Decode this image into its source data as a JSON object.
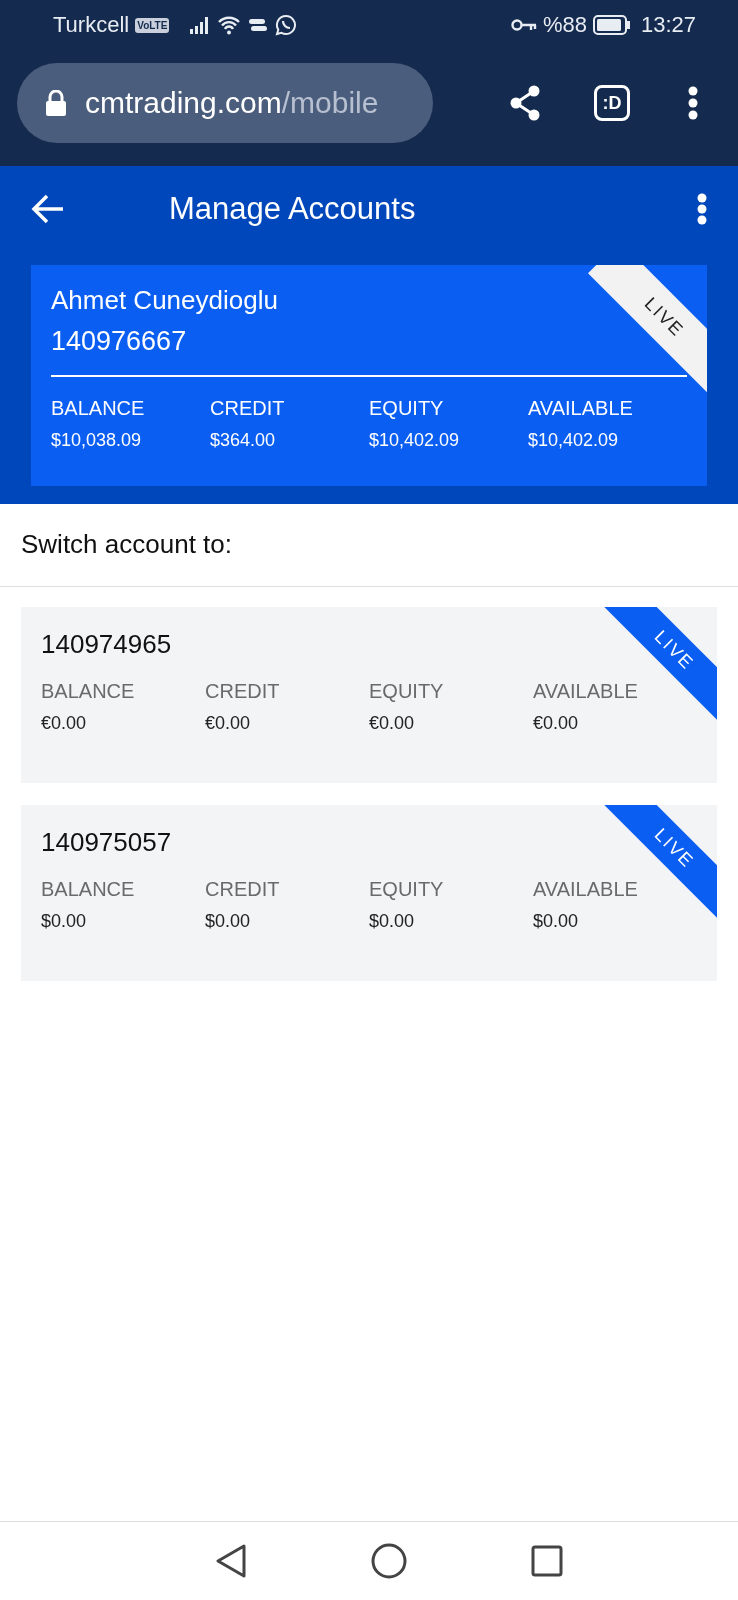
{
  "status_bar": {
    "carrier": "Turkcell",
    "network_badge": "VoLTE",
    "battery_percent": "%88",
    "time": "13:27"
  },
  "browser": {
    "url_domain": "cmtrading.com",
    "url_path": "/mobile",
    "tab_button": ":D"
  },
  "app_bar": {
    "title": "Manage Accounts"
  },
  "current_account": {
    "name": "Ahmet Cuneydioglu",
    "number": "140976667",
    "ribbon": "LIVE",
    "stats": [
      {
        "label": "BALANCE",
        "value": "$10,038.09"
      },
      {
        "label": "CREDIT",
        "value": "$364.00"
      },
      {
        "label": "EQUITY",
        "value": "$10,402.09"
      },
      {
        "label": "AVAILABLE",
        "value": "$10,402.09"
      }
    ]
  },
  "switch_heading": "Switch account to:",
  "accounts": [
    {
      "number": "140974965",
      "ribbon": "LIVE",
      "stats": [
        {
          "label": "BALANCE",
          "value": "€0.00"
        },
        {
          "label": "CREDIT",
          "value": "€0.00"
        },
        {
          "label": "EQUITY",
          "value": "€0.00"
        },
        {
          "label": "AVAILABLE",
          "value": "€0.00"
        }
      ]
    },
    {
      "number": "140975057",
      "ribbon": "LIVE",
      "stats": [
        {
          "label": "BALANCE",
          "value": "$0.00"
        },
        {
          "label": "CREDIT",
          "value": "$0.00"
        },
        {
          "label": "EQUITY",
          "value": "$0.00"
        },
        {
          "label": "AVAILABLE",
          "value": "$0.00"
        }
      ]
    }
  ]
}
